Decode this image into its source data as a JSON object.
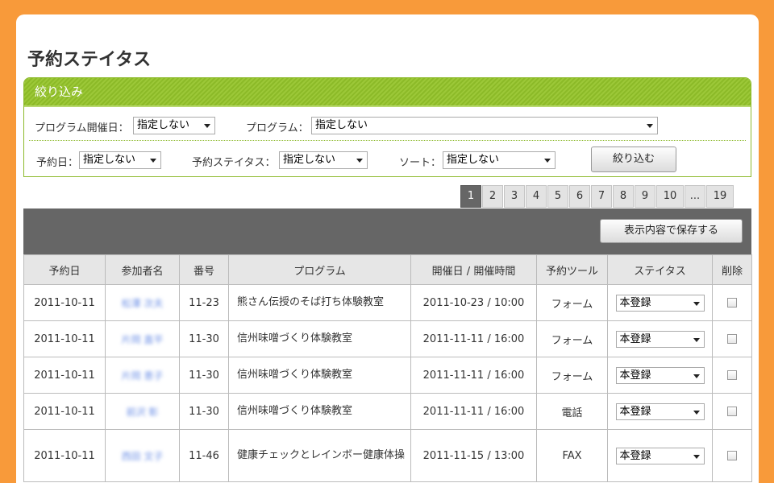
{
  "page_title": "予約ステイタス",
  "filter": {
    "heading": "絞り込み",
    "program_date_label": "プログラム開催日：",
    "program_date_value": "指定しない",
    "program_label": "プログラム：",
    "program_value": "指定しない",
    "reserve_date_label": "予約日：",
    "reserve_date_value": "指定しない",
    "status_label": "予約ステイタス：",
    "status_value": "指定しない",
    "sort_label": "ソート：",
    "sort_value": "指定しない",
    "submit_label": "絞り込む"
  },
  "pager": [
    "1",
    "2",
    "3",
    "4",
    "5",
    "6",
    "7",
    "8",
    "9",
    "10",
    "...",
    "19"
  ],
  "pager_current": "1",
  "toolbar": {
    "save_label": "表示内容で保存する"
  },
  "table": {
    "headers": [
      "予約日",
      "参加者名",
      "番号",
      "プログラム",
      "開催日 / 開催時間",
      "予約ツール",
      "ステイタス",
      "削除"
    ],
    "rows": [
      {
        "date": "2011-10-11",
        "name": "松澤 次夫",
        "num": "11-23",
        "program": "熊さん伝授のそば打ち体験教室",
        "event": "2011-10-23 / 10:00",
        "tool": "フォーム",
        "status": "本登録"
      },
      {
        "date": "2011-10-11",
        "name": "片岡 直平",
        "num": "11-30",
        "program": "信州味噌づくり体験教室",
        "event": "2011-11-11 / 16:00",
        "tool": "フォーム",
        "status": "本登録"
      },
      {
        "date": "2011-10-11",
        "name": "片岡 恵子",
        "num": "11-30",
        "program": "信州味噌づくり体験教室",
        "event": "2011-11-11 / 16:00",
        "tool": "フォーム",
        "status": "本登録"
      },
      {
        "date": "2011-10-11",
        "name": "前沢 彰",
        "num": "11-30",
        "program": "信州味噌づくり体験教室",
        "event": "2011-11-11 / 16:00",
        "tool": "電話",
        "status": "本登録"
      },
      {
        "date": "2011-10-11",
        "name": "西田 文子",
        "num": "11-46",
        "program": "健康チェックとレインボー健康体操",
        "event": "2011-11-15 / 13:00",
        "tool": "FAX",
        "status": "本登録"
      }
    ]
  }
}
